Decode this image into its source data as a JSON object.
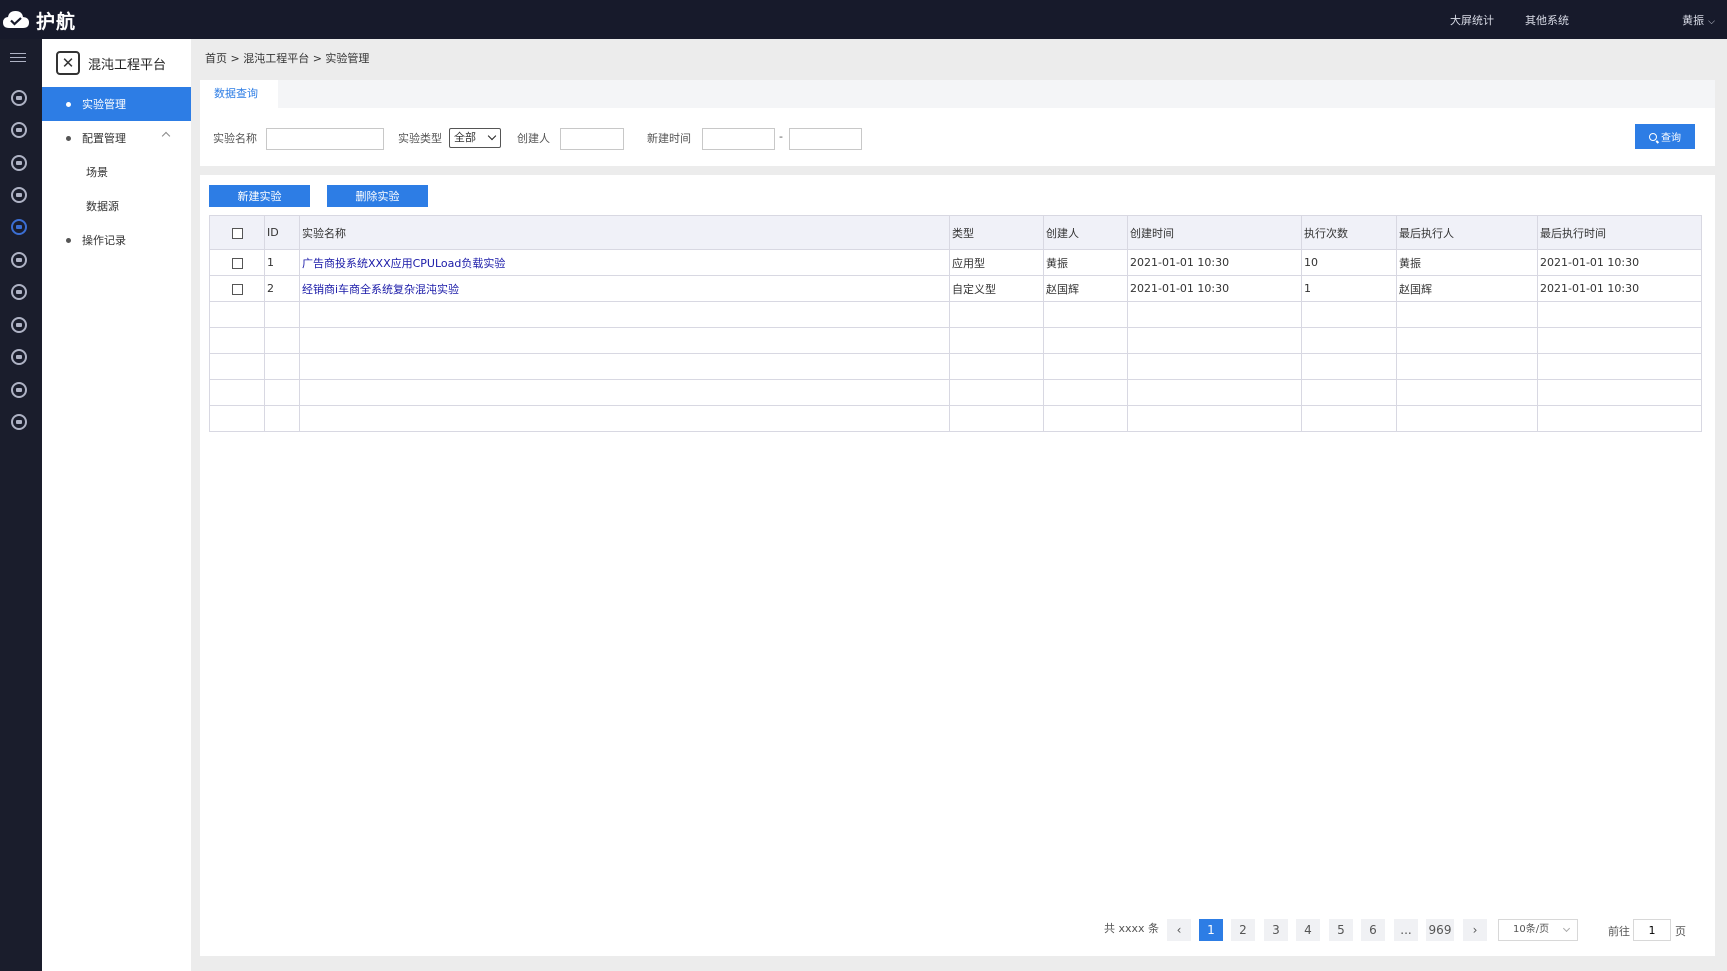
{
  "app": {
    "brand": "护航",
    "top_links": [
      "大屏统计",
      "其他系统"
    ],
    "user": "黄振"
  },
  "sidebar": {
    "platform_title": "混沌工程平台",
    "items": [
      {
        "label": "实验管理",
        "active": true
      },
      {
        "label": "配置管理",
        "expanded": true
      },
      {
        "label": "场景"
      },
      {
        "label": "数据源"
      },
      {
        "label": "操作记录"
      }
    ]
  },
  "breadcrumb": "首页 > 混沌工程平台 > 实验管理",
  "query": {
    "tab": "数据查询",
    "name_label": "实验名称",
    "name_value": "",
    "type_label": "实验类型",
    "type_value": "全部",
    "creator_label": "创建人",
    "creator_value": "",
    "time_label": "新建时间",
    "time_sep": "-",
    "time_start": "",
    "time_end": "",
    "search_label": "查询"
  },
  "toolbar": {
    "new_label": "新建实验",
    "delete_label": "删除实验"
  },
  "table": {
    "columns": [
      "ID",
      "实验名称",
      "类型",
      "创建人",
      "创建时间",
      "执行次数",
      "最后执行人",
      "最后执行时间"
    ],
    "rows": [
      [
        "1",
        "广告商投系统XXX应用CPULoad负载实验",
        "应用型",
        "黄振",
        "2021-01-01 10:30",
        "10",
        "黄振",
        "2021-01-01 10:30"
      ],
      [
        "2",
        "经销商i车商全系统复杂混沌实验",
        "自定义型",
        "赵国辉",
        "2021-01-01 10:30",
        "1",
        "赵国辉",
        "2021-01-01 10:30"
      ]
    ],
    "empty_rows": 5
  },
  "pagination": {
    "total": "共 xxxx 条",
    "pages": [
      "1",
      "2",
      "3",
      "4",
      "5",
      "6",
      "...",
      "969"
    ],
    "current": "1",
    "prev": "‹",
    "next": "›",
    "page_size": "10条/页",
    "goto_label": "前往",
    "goto_value": "1",
    "goto_suffix": "页"
  },
  "colors": {
    "accent": "#2d7de5",
    "topbar": "#171a2b",
    "link": "#1a1aa8"
  }
}
